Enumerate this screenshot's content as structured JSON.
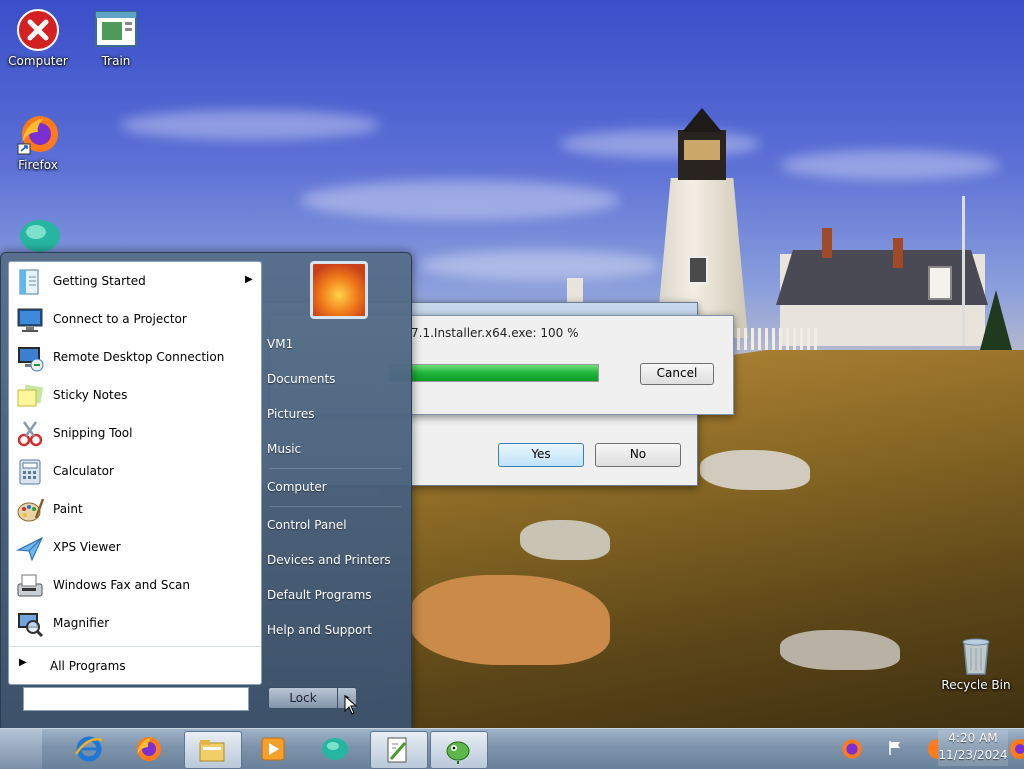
{
  "desktop": {
    "icons": [
      {
        "label": "Computer"
      },
      {
        "label": "Train"
      },
      {
        "label": "Firefox"
      },
      {
        "label": "Recycle Bin"
      }
    ]
  },
  "download_dialog": {
    "status_text": "7.1.Installer.x64.exe: 100 %",
    "progress_percent": 100,
    "cancel_label": "Cancel"
  },
  "confirm_dialog": {
    "yes_label": "Yes",
    "no_label": "No"
  },
  "start_menu": {
    "programs": [
      {
        "label": "Getting Started",
        "icon": "getting-started-icon",
        "submenu": true
      },
      {
        "label": "Connect to a Projector",
        "icon": "projector-icon"
      },
      {
        "label": "Remote Desktop Connection",
        "icon": "remote-desktop-icon"
      },
      {
        "label": "Sticky Notes",
        "icon": "sticky-notes-icon"
      },
      {
        "label": "Snipping Tool",
        "icon": "scissors-icon"
      },
      {
        "label": "Calculator",
        "icon": "calculator-icon"
      },
      {
        "label": "Paint",
        "icon": "paint-palette-icon"
      },
      {
        "label": "XPS Viewer",
        "icon": "xps-viewer-icon"
      },
      {
        "label": "Windows Fax and Scan",
        "icon": "fax-icon"
      },
      {
        "label": "Magnifier",
        "icon": "magnifier-icon"
      }
    ],
    "all_programs_label": "All Programs",
    "search_placeholder": "",
    "right_items": [
      {
        "label": "VM1"
      },
      {
        "label": "Documents"
      },
      {
        "label": "Pictures"
      },
      {
        "label": "Music"
      },
      {
        "label": "Computer"
      },
      {
        "label": "Control Panel"
      },
      {
        "label": "Devices and Printers"
      },
      {
        "label": "Default Programs"
      },
      {
        "label": "Help and Support"
      }
    ],
    "lock_label": "Lock",
    "lock_arrow": "▸"
  },
  "taskbar": {
    "clock_time": "4:20 AM",
    "clock_date": "11/23/2024"
  }
}
